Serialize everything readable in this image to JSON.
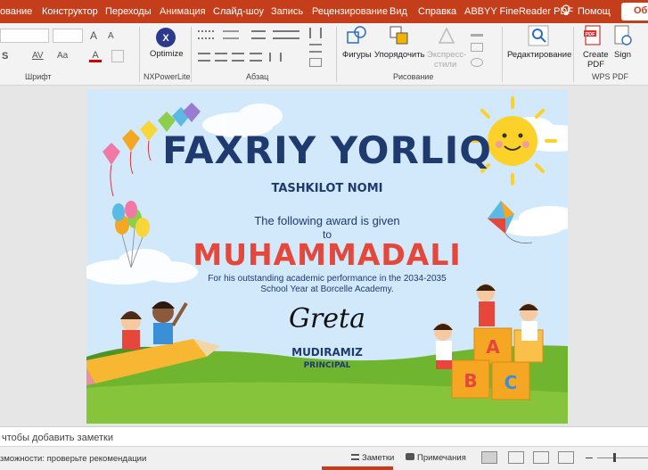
{
  "tabs": [
    "ование",
    "Конструктор",
    "Переходы",
    "Анимация",
    "Слайд-шоу",
    "Запись",
    "Рецензирование",
    "Вид",
    "Справка",
    "ABBYY FineReader PDF"
  ],
  "help_search": "Помощ",
  "share_label": "Об",
  "ribbon": {
    "groups": {
      "font": "Шрифт",
      "nxpowerlite": "NXPowerLite",
      "paragraph": "Абзац",
      "drawing": "Рисование",
      "wps_pdf": "WPS PDF"
    },
    "buttons": {
      "optimize": "Optimize",
      "shapes": "Фигуры",
      "arrange": "Упорядочить",
      "quick_styles_1": "Экспресс-",
      "quick_styles_2": "стили",
      "editing": "Редактирование",
      "create_pdf_1": "Create",
      "create_pdf_2": "PDF",
      "sign": "Sign"
    },
    "font_size_glyphs": {
      "grow": "A",
      "shrink": "A",
      "s_letter": "S",
      "spacing": "AV",
      "case": "Aa"
    }
  },
  "slide": {
    "title": "FAXRIY YORLIQ",
    "organization": "TASHKILOT NOMI",
    "award_line": "The following award is given",
    "to": "to",
    "recipient": "MUHAMMADALI",
    "reason_line1": "For his outstanding academic performance in the 2034-2035",
    "reason_line2": "School Year at Borcelle Academy.",
    "signature": "Greta",
    "signer": "MUDIRAMIZ",
    "signer_role": "PRINCIPAL",
    "blocks": [
      "A",
      "B",
      "C"
    ],
    "pdf_badge": "PDF"
  },
  "notes_placeholder": "чтобы добавить заметки",
  "status": {
    "accessibility": "зможности: проверьте рекомендации",
    "notes_button": "Заметки",
    "comments_button": "Примечания",
    "zoom_minus": "–"
  },
  "colors": {
    "tab_bar": "#c43e1c",
    "title": "#1f3a6e",
    "recipient": "#e5473a",
    "sky": "#d2e8fb",
    "grass": "#6fb52f"
  }
}
